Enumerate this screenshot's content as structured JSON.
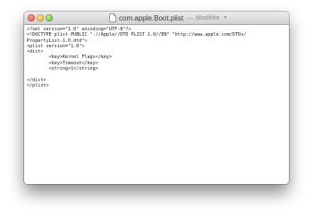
{
  "window": {
    "title": "com.apple.Boot.plist",
    "separator": "—",
    "status": "Modifiée"
  },
  "editor": {
    "lines": [
      "<?xml version=\"1.0\" encoding=\"UTF-8\"?>",
      "<!DOCTYPE plist PUBLIC \"-//Apple//DTD PLIST 1.0//EN\" \"http://www.apple.com/DTDs/",
      "PropertyList-1.0.dtd\">",
      "<plist version=\"1.0\">",
      "<dict>",
      "        <key>Kernel Flags</key>",
      "        <key>Timeout</key>",
      "        <string>1</string>",
      "",
      "</dict>",
      "</plist>"
    ]
  }
}
